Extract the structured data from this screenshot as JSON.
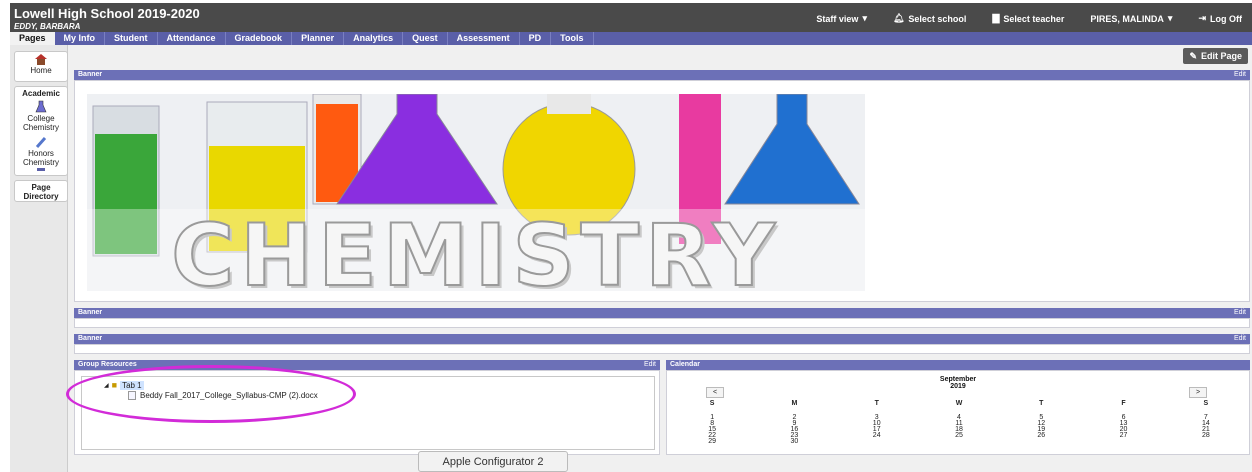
{
  "header": {
    "school": "Lowell High School 2019-2020",
    "student": "EDDY, BARBARA",
    "staff_view": "Staff view",
    "select_school": "Select school",
    "select_teacher": "Select teacher",
    "user": "PIRES, MALINDA",
    "logoff": "Log Off"
  },
  "nav": {
    "tabs": [
      "Pages",
      "My Info",
      "Student",
      "Attendance",
      "Gradebook",
      "Planner",
      "Analytics",
      "Quest",
      "Assessment",
      "PD",
      "Tools"
    ],
    "active": "Pages"
  },
  "sidebar": {
    "home": "Home",
    "academic_heading": "Academic",
    "college_chem": "College Chemistry",
    "honors_chem": "Honors Chemistry",
    "page_directory": "Page Directory"
  },
  "main": {
    "edit_page": "Edit Page",
    "banner_title": "Banner",
    "edit": "Edit",
    "banner_word": "CHEMISTRY",
    "banner2_title": "Banner",
    "banner3_title": "Banner"
  },
  "resources": {
    "title": "Group Resources",
    "edit": "Edit",
    "tab_label": "Tab 1",
    "file": "Beddy Fall_2017_College_Syllabus-CMP (2).docx"
  },
  "calendar": {
    "title": "Calendar",
    "month": "September",
    "year": "2019",
    "prev": "<",
    "next": ">",
    "days": [
      "S",
      "M",
      "T",
      "W",
      "T",
      "F",
      "S"
    ],
    "weeks": [
      [
        "1",
        "2",
        "3",
        "4",
        "5",
        "6",
        "7"
      ],
      [
        "8",
        "9",
        "10",
        "11",
        "12",
        "13",
        "14"
      ],
      [
        "15",
        "16",
        "17",
        "18",
        "19",
        "20",
        "21"
      ],
      [
        "22",
        "23",
        "24",
        "25",
        "26",
        "27",
        "28"
      ],
      [
        "29",
        "30",
        "",
        "",
        "",
        "",
        ""
      ]
    ]
  },
  "tooltip": "Apple Configurator 2",
  "colors": {
    "topbar": "#4a4a4a",
    "nav": "#5a5fa8",
    "panel_header": "#6c70b7",
    "annotation": "#d22bd8"
  }
}
